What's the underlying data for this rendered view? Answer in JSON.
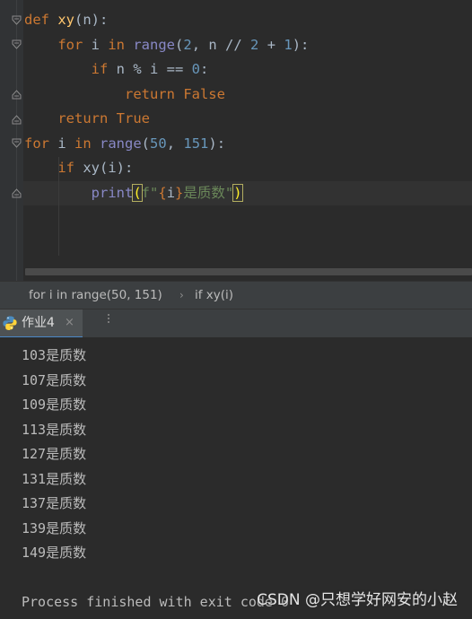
{
  "editor": {
    "lines": [
      {
        "tokens": [
          {
            "t": "def ",
            "c": "kw"
          },
          {
            "t": "xy",
            "c": "fn"
          },
          {
            "t": "(n):",
            "c": ""
          }
        ]
      },
      {
        "tokens": [
          {
            "t": "    ",
            "c": ""
          },
          {
            "t": "for ",
            "c": "kw"
          },
          {
            "t": "i ",
            "c": ""
          },
          {
            "t": "in ",
            "c": "kw"
          },
          {
            "t": "range",
            "c": "bi"
          },
          {
            "t": "(",
            "c": ""
          },
          {
            "t": "2",
            "c": "num"
          },
          {
            "t": ", n // ",
            "c": ""
          },
          {
            "t": "2",
            "c": "num"
          },
          {
            "t": " + ",
            "c": ""
          },
          {
            "t": "1",
            "c": "num"
          },
          {
            "t": "):",
            "c": ""
          }
        ]
      },
      {
        "tokens": [
          {
            "t": "        ",
            "c": ""
          },
          {
            "t": "if ",
            "c": "kw"
          },
          {
            "t": "n % i == ",
            "c": ""
          },
          {
            "t": "0",
            "c": "num"
          },
          {
            "t": ":",
            "c": ""
          }
        ]
      },
      {
        "tokens": [
          {
            "t": "            ",
            "c": ""
          },
          {
            "t": "return ",
            "c": "kw"
          },
          {
            "t": "False",
            "c": "kw"
          }
        ]
      },
      {
        "tokens": [
          {
            "t": "    ",
            "c": ""
          },
          {
            "t": "return ",
            "c": "kw"
          },
          {
            "t": "True",
            "c": "kw"
          }
        ]
      },
      {
        "tokens": [
          {
            "t": "for ",
            "c": "kw"
          },
          {
            "t": "i ",
            "c": ""
          },
          {
            "t": "in ",
            "c": "kw"
          },
          {
            "t": "range",
            "c": "bi"
          },
          {
            "t": "(",
            "c": ""
          },
          {
            "t": "50",
            "c": "num"
          },
          {
            "t": ", ",
            "c": ""
          },
          {
            "t": "151",
            "c": "num"
          },
          {
            "t": "):",
            "c": ""
          }
        ]
      },
      {
        "tokens": [
          {
            "t": "    ",
            "c": ""
          },
          {
            "t": "if ",
            "c": "kw"
          },
          {
            "t": "xy(i):",
            "c": ""
          }
        ]
      },
      {
        "tokens": [
          {
            "t": "        ",
            "c": ""
          },
          {
            "t": "print",
            "c": "bi"
          },
          {
            "t": "(",
            "c": "caret-box"
          },
          {
            "t": "f\"",
            "c": "str"
          },
          {
            "t": "{",
            "c": "brace"
          },
          {
            "t": "i",
            "c": ""
          },
          {
            "t": "}",
            "c": "brace"
          },
          {
            "t": "是质数\"",
            "c": "str"
          },
          {
            "t": ")",
            "c": "caret-box"
          }
        ],
        "current": true
      },
      {
        "tokens": []
      }
    ]
  },
  "breadcrumbs": {
    "items": [
      "for i in range(50, 151)",
      "if xy(i)"
    ],
    "separator": "›"
  },
  "run_panel": {
    "tab_label": "作业4",
    "close_glyph": "×"
  },
  "console": {
    "lines": [
      "103是质数",
      "107是质数",
      "109是质数",
      "113是质数",
      "127是质数",
      "131是质数",
      "137是质数",
      "139是质数",
      "149是质数",
      "",
      "Process finished with exit code 0"
    ]
  },
  "watermark": "CSDN @只想学好网安的小赵",
  "colors": {
    "keyword": "#cc7832",
    "function": "#ffc66d",
    "number": "#6897bb",
    "builtin": "#8888c6",
    "string": "#6a8759",
    "text": "#a9b7c6",
    "tab_accent": "#4a88c7"
  }
}
